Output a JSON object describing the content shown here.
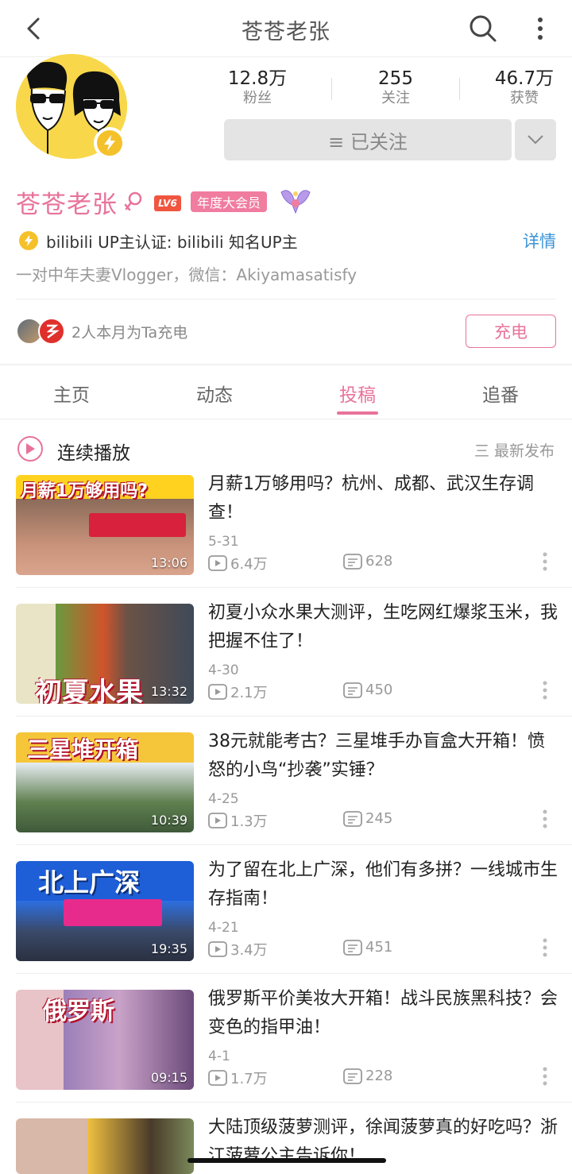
{
  "header": {
    "title": "苍苍老张"
  },
  "profile": {
    "stats": [
      {
        "value": "12.8万",
        "label": "粉丝"
      },
      {
        "value": "255",
        "label": "关注"
      },
      {
        "value": "46.7万",
        "label": "获赞"
      }
    ],
    "follow_label": "≡ 已关注",
    "name": "苍苍老张",
    "level": "LV6",
    "vip_label": "年度大会员",
    "verify_text": "bilibili  UP主认证: bilibili  知名UP主",
    "detail_link": "详情",
    "bio": "一对中年夫妻Vlogger，微信：Akiyamasatisfy",
    "charge_text": "2人本月为Ta充电",
    "charge_button": "充电"
  },
  "tabs": [
    "主页",
    "动态",
    "投稿",
    "追番"
  ],
  "active_tab": "投稿",
  "playbar": {
    "label": "连续播放",
    "sort": "三 最新发布"
  },
  "videos": [
    {
      "title": "月薪1万够用吗？杭州、成都、武汉生存调查！",
      "date": "5-31",
      "plays": "6.4万",
      "danmu": "628",
      "duration": "13:06",
      "thumb_text": "月薪1万够用吗?"
    },
    {
      "title": "初夏小众水果大测评，生吃网红爆浆玉米，我把握不住了！",
      "date": "4-30",
      "plays": "2.1万",
      "danmu": "450",
      "duration": "13:32",
      "thumb_text": "初夏水果"
    },
    {
      "title": "38元就能考古？三星堆手办盲盒大开箱！愤怒的小鸟“抄袭”实锤？",
      "date": "4-25",
      "plays": "1.3万",
      "danmu": "245",
      "duration": "10:39",
      "thumb_text": "三星堆开箱"
    },
    {
      "title": "为了留在北上广深，他们有多拼？一线城市生存指南！",
      "date": "4-21",
      "plays": "3.4万",
      "danmu": "451",
      "duration": "19:35",
      "thumb_text": "北上广深"
    },
    {
      "title": "俄罗斯平价美妆大开箱！战斗民族黑科技？会变色的指甲油！",
      "date": "4-1",
      "plays": "1.7万",
      "danmu": "228",
      "duration": "09:15",
      "thumb_text": "俄罗斯"
    },
    {
      "title": "大陆顶级菠萝测评，徐闻菠萝真的好吃吗？浙江菠萝公主告诉你！",
      "date": "",
      "plays": "",
      "danmu": "",
      "duration": "",
      "thumb_text": ""
    }
  ],
  "colors": {
    "accent": "#e8739a",
    "link": "#3b93d8",
    "avatar_bg": "#f8d84a"
  }
}
